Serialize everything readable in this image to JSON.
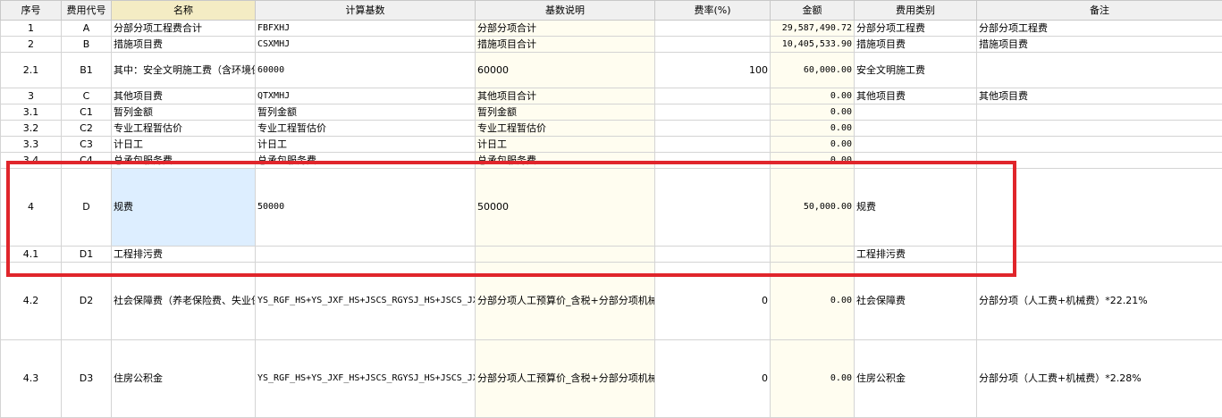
{
  "columns": [
    "序号",
    "费用代号",
    "名称",
    "计算基数",
    "基数说明",
    "费率(%)",
    "金额",
    "费用类别",
    "备注"
  ],
  "rows": [
    {
      "seq": "1",
      "code": "A",
      "name": "分部分项工程费合计",
      "base": "FBFXHJ",
      "desc": "分部分项合计",
      "rate": "",
      "amount": "29,587,490.72",
      "category": "分部分项工程费",
      "note": "分部分项工程费"
    },
    {
      "seq": "2",
      "code": "B",
      "name": "措施项目费",
      "base": "CSXMHJ",
      "desc": "措施项目合计",
      "rate": "",
      "amount": "10,405,533.90",
      "category": "措施项目费",
      "note": "措施项目费"
    },
    {
      "seq": "2.1",
      "code": "B1",
      "name": "其中：安全文明施工费（含环境保护、文明施工、安全施工、临时设施）",
      "base": "60000",
      "desc": "60000",
      "rate": "100",
      "amount": "60,000.00",
      "category": "安全文明施工费",
      "note": ""
    },
    {
      "seq": "3",
      "code": "C",
      "name": "其他项目费",
      "base": "QTXMHJ",
      "desc": "其他项目合计",
      "rate": "",
      "amount": "0.00",
      "category": "其他项目费",
      "note": "其他项目费"
    },
    {
      "seq": "3.1",
      "code": "C1",
      "name": "暂列金额",
      "base": "暂列金额",
      "desc": "暂列金额",
      "rate": "",
      "amount": "0.00",
      "category": "",
      "note": ""
    },
    {
      "seq": "3.2",
      "code": "C2",
      "name": "专业工程暂估价",
      "base": "专业工程暂估价",
      "desc": "专业工程暂估价",
      "rate": "",
      "amount": "0.00",
      "category": "",
      "note": ""
    },
    {
      "seq": "3.3",
      "code": "C3",
      "name": "计日工",
      "base": "计日工",
      "desc": "计日工",
      "rate": "",
      "amount": "0.00",
      "category": "",
      "note": ""
    },
    {
      "seq": "3.4",
      "code": "C4",
      "name": "总承包服务费",
      "base": "总承包服务费",
      "desc": "总承包服务费",
      "rate": "",
      "amount": "0.00",
      "category": "",
      "note": ""
    },
    {
      "seq": "4",
      "code": "D",
      "name": "规费",
      "base": "50000",
      "desc": "50000",
      "rate": "",
      "amount": "50,000.00",
      "category": "规费",
      "note": ""
    },
    {
      "seq": "4.1",
      "code": "D1",
      "name": "工程排污费",
      "base": "",
      "desc": "",
      "rate": "",
      "amount": "",
      "category": "工程排污费",
      "note": ""
    },
    {
      "seq": "4.2",
      "code": "D2",
      "name": "社会保障费（养老保险费、失业保险费、医疗保险费）",
      "base": "YS_RGF_HS+YS_JXF_HS+JSCS_RGYSJ_HS+JSCS_JXYSJ_HS-JCC_CZYS_JX_RGFYSJ_HS-JCC_CZYS_JX_JXFYSJ_HS-YS_JXZJF_HS",
      "desc": "分部分项人工预算价_含税+分部分项机械预算价_含税+技术措施人工预算价_含税+技术措施机械预算价_含税-大型机械进出场及垂直运输人工费预算价_含税-大型机械进出场及垂直运输机械费预算价_含税-超高降效直接费预算价_含税",
      "rate": "0",
      "amount": "0.00",
      "category": "社会保障费",
      "note": "分部分项（人工费+机械费）*22.21%"
    },
    {
      "seq": "4.3",
      "code": "D3",
      "name": "住房公积金",
      "base": "YS_RGF_HS+YS_JXF_HS+JSCS_RGYSJ_HS+JSCS_JXYSJ_HS-JCC_CZYS_JX_RGFYSJ_HS",
      "desc": "分部分项人工预算价_含税+分部分项机械预算价_含税+技术措施人工预算价_含税+技术措施机械预算价_含税",
      "rate": "0",
      "amount": "0.00",
      "category": "住房公积金",
      "note": "分部分项（人工费+机械费）*2.28%"
    }
  ]
}
